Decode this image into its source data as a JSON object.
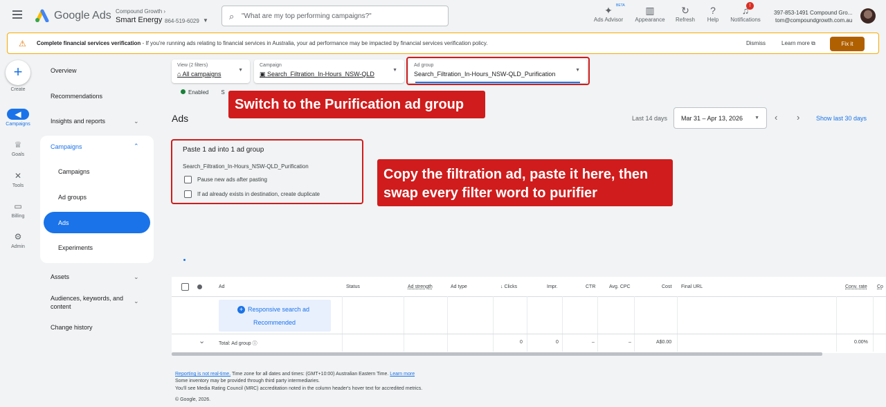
{
  "header": {
    "brand": "Google Ads",
    "account_parent": "Compound Growth",
    "account_name": "Smart Energy",
    "account_id": "864-519-6029",
    "search_placeholder": "\"What are my top performing campaigns?\"",
    "tools": [
      {
        "label": "Ads Advisor",
        "icon": "sparkle-icon"
      },
      {
        "label": "Appearance",
        "icon": "appearance-icon"
      },
      {
        "label": "Refresh",
        "icon": "refresh-icon"
      },
      {
        "label": "Help",
        "icon": "help-icon"
      },
      {
        "label": "Notifications",
        "icon": "bell-icon"
      }
    ],
    "beta": "BETA",
    "notif_count": "!",
    "user_line1": "397-853-1491 Compound Gro...",
    "user_line2": "tom@compoundgrowth.com.au"
  },
  "banner": {
    "title": "Complete financial services verification",
    "text": " - If you're running ads relating to financial services in Australia, your ad performance may be impacted by financial services verification policy.",
    "dismiss": "Dismiss",
    "learn_more": "Learn more",
    "fix_it": "Fix it"
  },
  "rail": {
    "create": "Create",
    "items": [
      "Campaigns",
      "Goals",
      "Tools",
      "Billing",
      "Admin"
    ]
  },
  "nav": {
    "overview": "Overview",
    "recommendations": "Recommendations",
    "insights": "Insights and reports",
    "campaigns": "Campaigns",
    "sub": [
      "Campaigns",
      "Ad groups",
      "Ads",
      "Experiments"
    ],
    "assets": "Assets",
    "audiences": "Audiences, keywords, and content",
    "change_history": "Change history"
  },
  "filters": {
    "view_label": "View (2 filters)",
    "view_value": "All campaigns",
    "campaign_label": "Campaign",
    "campaign_value": "Search_Filtration_In-Hours_NSW-QLD",
    "adgroup_label": "Ad group",
    "adgroup_value": "Search_Filtration_In-Hours_NSW-QLD_Purification",
    "status": "Enabled",
    "status_extra": "S"
  },
  "callouts": {
    "top": "Switch to the Purification ad group",
    "middle_line1": "Copy the filtration ad, paste it here, then",
    "middle_line2": "swap every filter word to purifier"
  },
  "ads": {
    "title": "Ads",
    "date_label": "Last 14 days",
    "date_range": "Mar 31 – Apr 13, 2026",
    "show_last": "Show last 30 days"
  },
  "paste": {
    "title": "Paste 1 ad into 1 ad group",
    "target": "Search_Filtration_In-Hours_NSW-QLD_Purification",
    "option1": "Pause new ads after pasting",
    "option2": "If ad already exists in destination, create duplicate"
  },
  "table": {
    "headers": [
      "Ad",
      "Status",
      "Ad strength",
      "Ad type",
      "↓ Clicks",
      "Impr.",
      "CTR",
      "Avg. CPC",
      "Cost",
      "Final URL",
      "Conv. rate",
      "Co"
    ],
    "rsa_label": "Responsive search ad",
    "rsa_sub": "Recommended",
    "total_label": "Total: Ad group",
    "total_values": [
      "0",
      "0",
      "–",
      "–",
      "A$0.00",
      "0.00%"
    ]
  },
  "footer": {
    "line1_link": "Reporting is not real-time.",
    "line1_text": " Time zone for all dates and times: (GMT+10:00) Australian Eastern Time. ",
    "line1_link2": "Learn more",
    "line2": "Some inventory may be provided through third party intermediaries.",
    "line3": "You'll see Media Rating Council (MRC) accreditation noted in the column header's hover text for accredited metrics.",
    "line4": "© Google, 2026."
  },
  "colors": {
    "accent": "#1a73e8",
    "callout": "#d01c1c",
    "warning": "#f9ab00",
    "fix_button": "#b06000"
  }
}
